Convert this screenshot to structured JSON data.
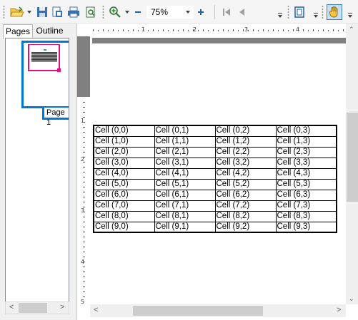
{
  "toolbar": {
    "zoom_value": "75%",
    "icons": [
      "open-folder-icon",
      "save-icon",
      "export-icon",
      "print-icon",
      "print-preview-icon",
      "zoom-icon",
      "zoom-out-icon",
      "zoom-in-icon",
      "first-page-icon",
      "previous-page-icon",
      "single-page-view-icon",
      "hand-tool-icon"
    ],
    "accent_color": "#0078d7"
  },
  "leftpanel": {
    "tabs": [
      {
        "label": "Pages",
        "active": true
      },
      {
        "label": "Outline",
        "active": false
      }
    ],
    "thumbnail_label": "Page 1"
  },
  "ruler": {
    "top_numbers": [
      "1",
      "2",
      "3",
      "4",
      "5"
    ],
    "left_numbers": [
      "1",
      "2",
      "3",
      "4",
      "5"
    ]
  },
  "table": {
    "rows": [
      [
        "Cell (0,0)",
        "Cell (0,1)",
        "Cell (0,2)",
        "Cell (0,3)"
      ],
      [
        "Cell (1,0)",
        "Cell (1,1)",
        "Cell (1,2)",
        "Cell (1,3)"
      ],
      [
        "Cell (2,0)",
        "Cell (2,1)",
        "Cell (2,2)",
        "Cell (2,3)"
      ],
      [
        "Cell (3,0)",
        "Cell (3,1)",
        "Cell (3,2)",
        "Cell (3,3)"
      ],
      [
        "Cell (4,0)",
        "Cell (4,1)",
        "Cell (4,2)",
        "Cell (4,3)"
      ],
      [
        "Cell (5,0)",
        "Cell (5,1)",
        "Cell (5,2)",
        "Cell (5,3)"
      ],
      [
        "Cell (6,0)",
        "Cell (6,1)",
        "Cell (6,2)",
        "Cell (6,3)"
      ],
      [
        "Cell (7,0)",
        "Cell (7,1)",
        "Cell (7,2)",
        "Cell (7,3)"
      ],
      [
        "Cell (8,0)",
        "Cell (8,1)",
        "Cell (8,2)",
        "Cell (8,3)"
      ],
      [
        "Cell (9,0)",
        "Cell (9,1)",
        "Cell (9,2)",
        "Cell (9,3)"
      ]
    ]
  }
}
